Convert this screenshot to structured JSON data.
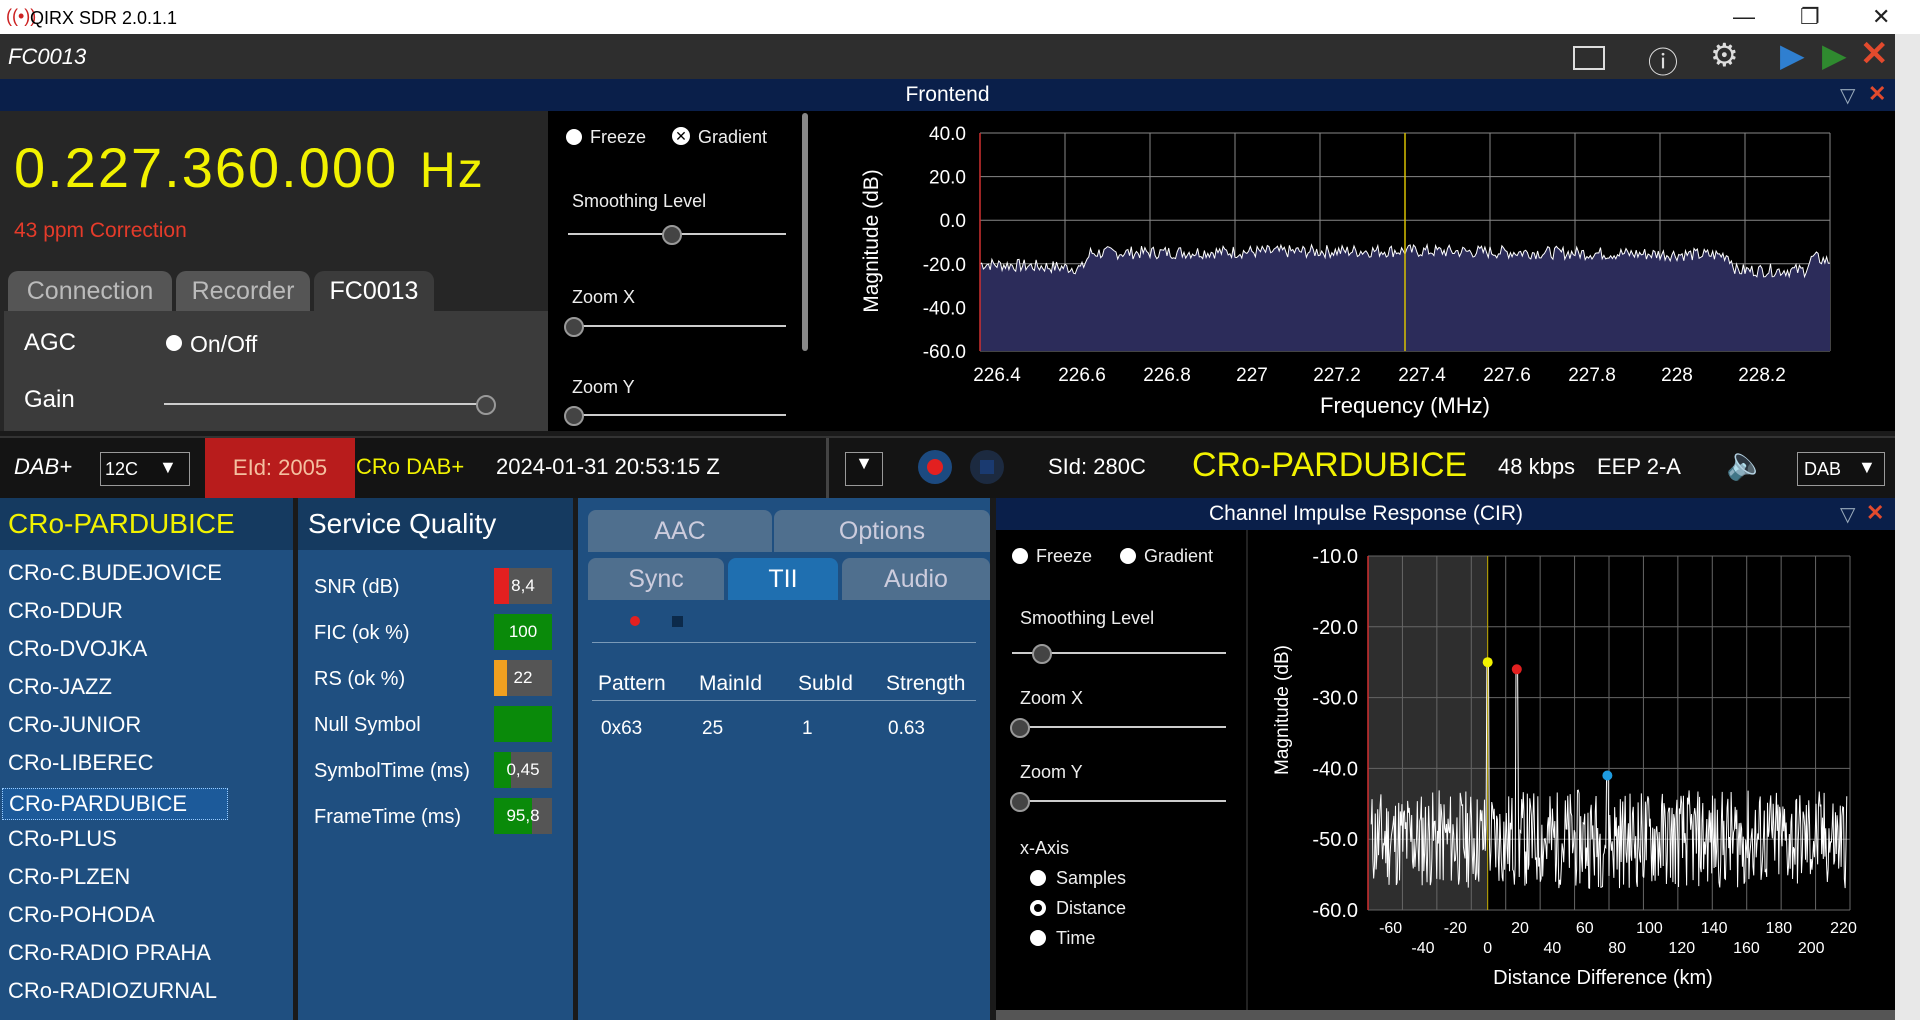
{
  "app": {
    "title": "QIRX SDR 2.0.1.1"
  },
  "device": {
    "name": "FC0013"
  },
  "frontend": {
    "title": "Frontend",
    "frequency": "0.227.360.000",
    "frequency_unit": "Hz",
    "ppm": "43 ppm Correction",
    "tabs": [
      "Connection",
      "Recorder",
      "FC0013"
    ],
    "agc_label": "AGC",
    "onoff_label": "On/Off",
    "gain_label": "Gain",
    "freeze_label": "Freeze",
    "gradient_label": "Gradient",
    "smoothing_label": "Smoothing Level",
    "zoomx_label": "Zoom X",
    "zoomy_label": "Zoom Y"
  },
  "status": {
    "mode": "DAB+",
    "channel": "12C",
    "eid": "EId: 2005",
    "ensemble": "CRo DAB+",
    "datetime": "2024-01-31  20:53:15 Z",
    "sid": "SId: 280C",
    "service": "CRo-PARDUBICE",
    "bitrate": "48 kbps",
    "protection": "EEP 2-A",
    "standard": "DAB"
  },
  "services": {
    "current": "CRo-PARDUBICE",
    "items": [
      "CRo-C.BUDEJOVICE",
      "CRo-DDUR",
      "CRo-DVOJKA",
      "CRo-JAZZ",
      "CRo-JUNIOR",
      "CRo-LIBEREC",
      "CRo-PARDUBICE",
      "CRo-PLUS",
      "CRo-PLZEN",
      "CRo-POHODA",
      "CRo-RADIO PRAHA",
      "CRo-RADIOZURNAL"
    ]
  },
  "quality": {
    "title": "Service Quality",
    "rows": [
      {
        "label": "SNR (dB)",
        "value": "8,4",
        "fill": 0.25,
        "color": "#e32020"
      },
      {
        "label": "FIC (ok %)",
        "value": "100",
        "fill": 1.0,
        "color": "#0a8a0a"
      },
      {
        "label": "RS (ok %)",
        "value": "22",
        "fill": 0.22,
        "color": "#f0a020"
      },
      {
        "label": "Null Symbol",
        "value": "",
        "fill": 1.0,
        "color": "#0a8a0a"
      },
      {
        "label": "SymbolTime (ms)",
        "value": "0,45",
        "fill": 0.3,
        "color": "#0a8a0a"
      },
      {
        "label": "FrameTime (ms)",
        "value": "95,8",
        "fill": 0.65,
        "color": "#0a8a0a"
      }
    ]
  },
  "tii": {
    "tabs_top": [
      "AAC",
      "Options"
    ],
    "tabs_bottom": [
      "Sync",
      "TII",
      "Audio"
    ],
    "headers": [
      "Pattern",
      "MainId",
      "SubId",
      "Strength"
    ],
    "row": [
      "0x63",
      "25",
      "1",
      "0.63"
    ]
  },
  "cir": {
    "title": "Channel Impulse Response (CIR)",
    "freeze_label": "Freeze",
    "gradient_label": "Gradient",
    "smoothing_label": "Smoothing Level",
    "zoomx_label": "Zoom X",
    "zoomy_label": "Zoom Y",
    "xaxis_label": "x-Axis",
    "options": [
      "Samples",
      "Distance",
      "Time"
    ],
    "selected": "Distance"
  },
  "chart_data": [
    {
      "type": "line",
      "title": "",
      "xlabel": "Frequency (MHz)",
      "ylabel": "Magnitude (dB)",
      "xlim": [
        226.36,
        228.36
      ],
      "ylim": [
        -60,
        40
      ],
      "xticks": [
        "226.4",
        "226.6",
        "226.8",
        "227",
        "227.2",
        "227.4",
        "227.6",
        "227.8",
        "228",
        "228.2"
      ],
      "yticks": [
        "40.0",
        "20.0",
        "0.0",
        "-20.0",
        "-40.0",
        "-60.0"
      ],
      "series": [
        {
          "x": [
            226.36,
            226.6,
            226.62,
            227.36,
            228.12,
            228.14,
            228.3,
            228.32,
            228.36
          ],
          "values": [
            -20,
            -22,
            -15,
            -14,
            -16,
            -23,
            -23,
            -17,
            -19
          ]
        }
      ],
      "marker_x": 227.36
    },
    {
      "type": "line",
      "title": "",
      "xlabel": "Distance Difference (km)",
      "ylabel": "Magnitude (dB)",
      "ylim": [
        -60,
        -10
      ],
      "xticks_top": [
        "-60",
        "-20",
        "20",
        "60",
        "100",
        "140",
        "180",
        "220"
      ],
      "xticks_bottom": [
        "-40",
        "0",
        "40",
        "80",
        "120",
        "160",
        "200"
      ],
      "yticks": [
        "-10.0",
        "-20.0",
        "-30.0",
        "-40.0",
        "-50.0",
        "-60.0"
      ],
      "markers": [
        {
          "x": 0,
          "y": -25,
          "color": "#f2f200"
        },
        {
          "x": 18,
          "y": -26,
          "color": "#e32020"
        },
        {
          "x": 74,
          "y": -41,
          "color": "#1e9be0"
        }
      ]
    }
  ]
}
